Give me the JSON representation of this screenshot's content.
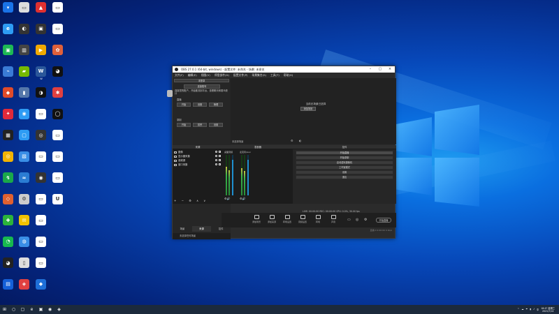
{
  "desktop": {
    "icons": [
      {
        "col": 0,
        "row": 0,
        "label": "",
        "color": "#1a73e8",
        "glyph": "▾"
      },
      {
        "col": 0,
        "row": 1,
        "label": "",
        "color": "#2e9cf4",
        "glyph": "e"
      },
      {
        "col": 0,
        "row": 2,
        "label": "",
        "color": "#1db954",
        "glyph": "▣"
      },
      {
        "col": 0,
        "row": 3,
        "label": "",
        "color": "#3a7bd5",
        "glyph": "⌁"
      },
      {
        "col": 0,
        "row": 4,
        "label": "",
        "color": "#e04b2a",
        "glyph": "◆"
      },
      {
        "col": 0,
        "row": 5,
        "label": "",
        "color": "#e02a3a",
        "glyph": "✦"
      },
      {
        "col": 0,
        "row": 6,
        "label": "",
        "color": "#222",
        "glyph": "▦"
      },
      {
        "col": 0,
        "row": 7,
        "label": "",
        "color": "#f2b300",
        "glyph": "◎"
      },
      {
        "col": 0,
        "row": 8,
        "label": "",
        "color": "#1aa84a",
        "glyph": "↯"
      },
      {
        "col": 0,
        "row": 9,
        "label": "",
        "color": "#e06030",
        "glyph": "◇"
      },
      {
        "col": 0,
        "row": 10,
        "label": "",
        "color": "#2bb33b",
        "glyph": "✚"
      },
      {
        "col": 0,
        "row": 11,
        "label": "",
        "color": "#17b84f",
        "glyph": "◔"
      },
      {
        "col": 0,
        "row": 12,
        "label": "",
        "color": "#222",
        "glyph": "◕"
      },
      {
        "col": 0,
        "row": 13,
        "label": "",
        "color": "#1560d8",
        "glyph": "▤"
      },
      {
        "col": 1,
        "row": 0,
        "label": "",
        "color": "#ddd",
        "glyph": "▭"
      },
      {
        "col": 1,
        "row": 1,
        "label": "",
        "color": "#333",
        "glyph": "◐"
      },
      {
        "col": 1,
        "row": 2,
        "label": "",
        "color": "#444",
        "glyph": "▥"
      },
      {
        "col": 1,
        "row": 3,
        "label": "",
        "color": "#76b900",
        "glyph": "▰"
      },
      {
        "col": 1,
        "row": 4,
        "label": "",
        "color": "#5577aa",
        "glyph": "▮"
      },
      {
        "col": 1,
        "row": 5,
        "label": "",
        "color": "#2e9cf4",
        "glyph": "◉"
      },
      {
        "col": 1,
        "row": 6,
        "label": "",
        "color": "#2e9cf4",
        "glyph": "▢"
      },
      {
        "col": 1,
        "row": 7,
        "label": "",
        "color": "#3a8ee6",
        "glyph": "▧"
      },
      {
        "col": 1,
        "row": 8,
        "label": "",
        "color": "#2b7cd3",
        "glyph": "≈"
      },
      {
        "col": 1,
        "row": 9,
        "label": "",
        "color": "#ccc",
        "glyph": "⚙"
      },
      {
        "col": 1,
        "row": 10,
        "label": "",
        "color": "#f2c200",
        "glyph": "✉"
      },
      {
        "col": 1,
        "row": 11,
        "label": "",
        "color": "#3a8ee6",
        "glyph": "◍"
      },
      {
        "col": 1,
        "row": 12,
        "label": "",
        "color": "#ddd",
        "glyph": "▯"
      },
      {
        "col": 1,
        "row": 13,
        "label": "",
        "color": "#e04040",
        "glyph": "◈"
      },
      {
        "col": 2,
        "row": 0,
        "label": "",
        "color": "#e03030",
        "glyph": "▲"
      },
      {
        "col": 2,
        "row": 1,
        "label": "",
        "color": "#333",
        "glyph": "▣"
      },
      {
        "col": 2,
        "row": 2,
        "label": "",
        "color": "#f2a900",
        "glyph": "▶"
      },
      {
        "col": 2,
        "row": 3,
        "label": "W",
        "color": "#2b579a",
        "glyph": "W"
      },
      {
        "col": 2,
        "row": 4,
        "label": "",
        "color": "#111",
        "glyph": "◑"
      },
      {
        "col": 2,
        "row": 5,
        "label": "",
        "color": "#fff",
        "glyph": "▭"
      },
      {
        "col": 2,
        "row": 6,
        "label": "",
        "color": "#333",
        "glyph": "◎"
      },
      {
        "col": 2,
        "row": 7,
        "label": "",
        "color": "#fff",
        "glyph": "▭"
      },
      {
        "col": 2,
        "row": 8,
        "label": "",
        "color": "#333",
        "glyph": "◉"
      },
      {
        "col": 2,
        "row": 9,
        "label": "",
        "color": "#fff",
        "glyph": "▭"
      },
      {
        "col": 2,
        "row": 10,
        "label": "",
        "color": "#fff",
        "glyph": "▭"
      },
      {
        "col": 2,
        "row": 11,
        "label": "",
        "color": "#fff",
        "glyph": "▭"
      },
      {
        "col": 2,
        "row": 12,
        "label": "",
        "color": "#fff",
        "glyph": "▭"
      },
      {
        "col": 2,
        "row": 13,
        "label": "",
        "color": "#1e6fd8",
        "glyph": "◆"
      },
      {
        "col": 3,
        "row": 0,
        "label": "",
        "color": "#fff",
        "glyph": "▭"
      },
      {
        "col": 3,
        "row": 1,
        "label": "",
        "color": "#fff",
        "glyph": "▭"
      },
      {
        "col": 3,
        "row": 2,
        "label": "",
        "color": "#e0603a",
        "glyph": "✿"
      },
      {
        "col": 3,
        "row": 3,
        "label": "",
        "color": "#111",
        "glyph": "◕"
      },
      {
        "col": 3,
        "row": 4,
        "label": "",
        "color": "#e04040",
        "glyph": "✱"
      },
      {
        "col": 3,
        "row": 5,
        "label": "",
        "color": "#111",
        "glyph": "◯"
      },
      {
        "col": 3,
        "row": 6,
        "label": "",
        "color": "#fff",
        "glyph": "▭"
      },
      {
        "col": 3,
        "row": 7,
        "label": "",
        "color": "#fff",
        "glyph": "▭"
      },
      {
        "col": 3,
        "row": 8,
        "label": "",
        "color": "#fff",
        "glyph": "▭"
      },
      {
        "col": 3,
        "row": 9,
        "label": "",
        "color": "#fff",
        "glyph": "U"
      }
    ]
  },
  "obs": {
    "title": "OBS 27.0.1 (64-bit, windows) - 配置文件: 未命名 - 场景: 未命名",
    "menu": [
      "文件(F)",
      "编辑(E)",
      "视图(V)",
      "停靠部件(D)",
      "配置文件(P)",
      "场景集合(S)",
      "工具(T)",
      "帮助(H)"
    ],
    "dock": {
      "select": "未登录",
      "login_button": "连接账号",
      "desc": "连接您的账户，开始推流到平台，查看聊天和观众统计",
      "section1": "直播",
      "section1_buttons": [
        "开始",
        "设置",
        "管理"
      ],
      "section2": "录制",
      "section2_buttons": [
        "开始",
        "暂停",
        "设置"
      ],
      "tabs": [
        "场景",
        "来源",
        "控件"
      ],
      "footer_text": "未选择任何场景"
    },
    "preview": {
      "noscene": "当前无场景已选择",
      "button": "添加场景",
      "status_left": "未选择场景"
    },
    "docks": {
      "sources_title": "来源",
      "mixer_title": "混音器",
      "controls_title": "控件",
      "sources": [
        "图像",
        "显示器采集",
        "音频源",
        "窗口采集"
      ],
      "mixer_left": "桌面音频",
      "mixer_right": "麦克风/Aux",
      "controls": [
        "开始直播",
        "开始录制",
        "启动虚拟摄像机",
        "工作室模式",
        "设置",
        "退出"
      ]
    },
    "statusbar": "LIVE: 00:00:00   REC: 00:00:00   CPU: 0.0%, 30.00 fps",
    "tools": [
      "添加场景",
      "添加来源",
      "转场设置",
      "音频设置",
      "转场",
      "声音"
    ],
    "golive": "开始直播",
    "footer": "直播  0  0:00:00  0 kb/s"
  },
  "taskbar": {
    "items": [
      "⊞",
      "○",
      "▢",
      "e",
      "▣",
      "◉",
      "◈"
    ],
    "tray": [
      "^",
      "☁",
      "☂",
      "▮",
      "♪",
      "中"
    ],
    "time": "16:47 星期三",
    "date": "2021/7/14"
  }
}
